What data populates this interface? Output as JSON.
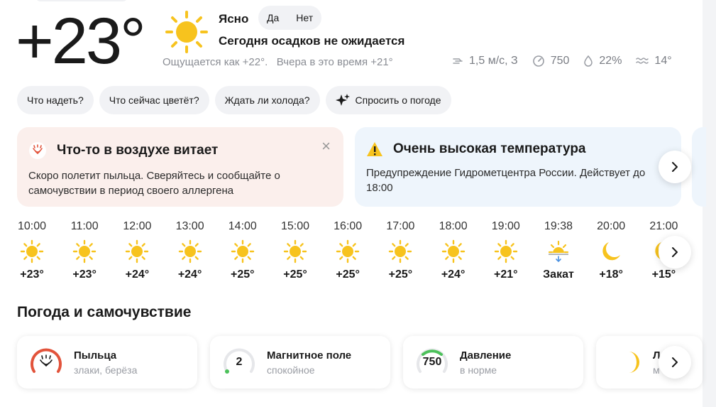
{
  "current": {
    "temperature": "+23°",
    "condition": "Ясно",
    "feedback_yes": "Да",
    "feedback_no": "Нет",
    "precipitation": "Сегодня осадков не ожидается",
    "feels_like": "Ощущается как +22°.",
    "yesterday": "Вчера в это время +21°",
    "wind": "1,5 м/с, З",
    "pressure": "750",
    "humidity": "22%",
    "water_temp": "14°"
  },
  "quick_questions": [
    "Что надеть?",
    "Что сейчас цветёт?",
    "Ждать ли холода?",
    "Спросить о погоде"
  ],
  "alerts": {
    "pollen": {
      "title": "Что-то в воздухе витает",
      "text": "Скоро полетит пыльца. Сверяйтесь и сообщайте о самочувствии в период своего аллергена",
      "close": "×"
    },
    "heat": {
      "title": "Очень высокая температура",
      "text": "Предупреждение Гидрометцентра России. Действует до 18:00"
    }
  },
  "hourly": [
    {
      "time": "10:00",
      "value": "+23°",
      "icon": "sun-icon"
    },
    {
      "time": "11:00",
      "value": "+23°",
      "icon": "sun-icon"
    },
    {
      "time": "12:00",
      "value": "+24°",
      "icon": "sun-icon"
    },
    {
      "time": "13:00",
      "value": "+24°",
      "icon": "sun-icon"
    },
    {
      "time": "14:00",
      "value": "+25°",
      "icon": "sun-icon"
    },
    {
      "time": "15:00",
      "value": "+25°",
      "icon": "sun-icon"
    },
    {
      "time": "16:00",
      "value": "+25°",
      "icon": "sun-icon"
    },
    {
      "time": "17:00",
      "value": "+25°",
      "icon": "sun-icon"
    },
    {
      "time": "18:00",
      "value": "+24°",
      "icon": "sun-icon"
    },
    {
      "time": "19:00",
      "value": "+21°",
      "icon": "sun-icon"
    },
    {
      "time": "19:38",
      "value": "Закат",
      "icon": "sunset-icon"
    },
    {
      "time": "20:00",
      "value": "+18°",
      "icon": "moon-icon"
    },
    {
      "time": "21:00",
      "value": "+15°",
      "icon": "moon-icon"
    }
  ],
  "wellbeing": {
    "title": "Погода и самочувствие",
    "cards": [
      {
        "title": "Пыльца",
        "sub": "злаки, берёза",
        "gauge": "",
        "icon": "pollen-icon"
      },
      {
        "title": "Магнитное поле",
        "sub": "спокойное",
        "gauge": "2",
        "icon": "magnetic-gauge-icon"
      },
      {
        "title": "Давление",
        "sub": "в норме",
        "gauge": "750",
        "icon": "pressure-gauge-icon"
      },
      {
        "title": "Л",
        "sub": "м",
        "gauge": "",
        "icon": "moon-phase-icon"
      }
    ]
  },
  "colors": {
    "sun": "#f7c31e",
    "pollen_card_bg": "#fbefec",
    "warning_card_bg": "#eef5fc",
    "pollen_red": "#e2533b",
    "green": "#4cc15a"
  }
}
